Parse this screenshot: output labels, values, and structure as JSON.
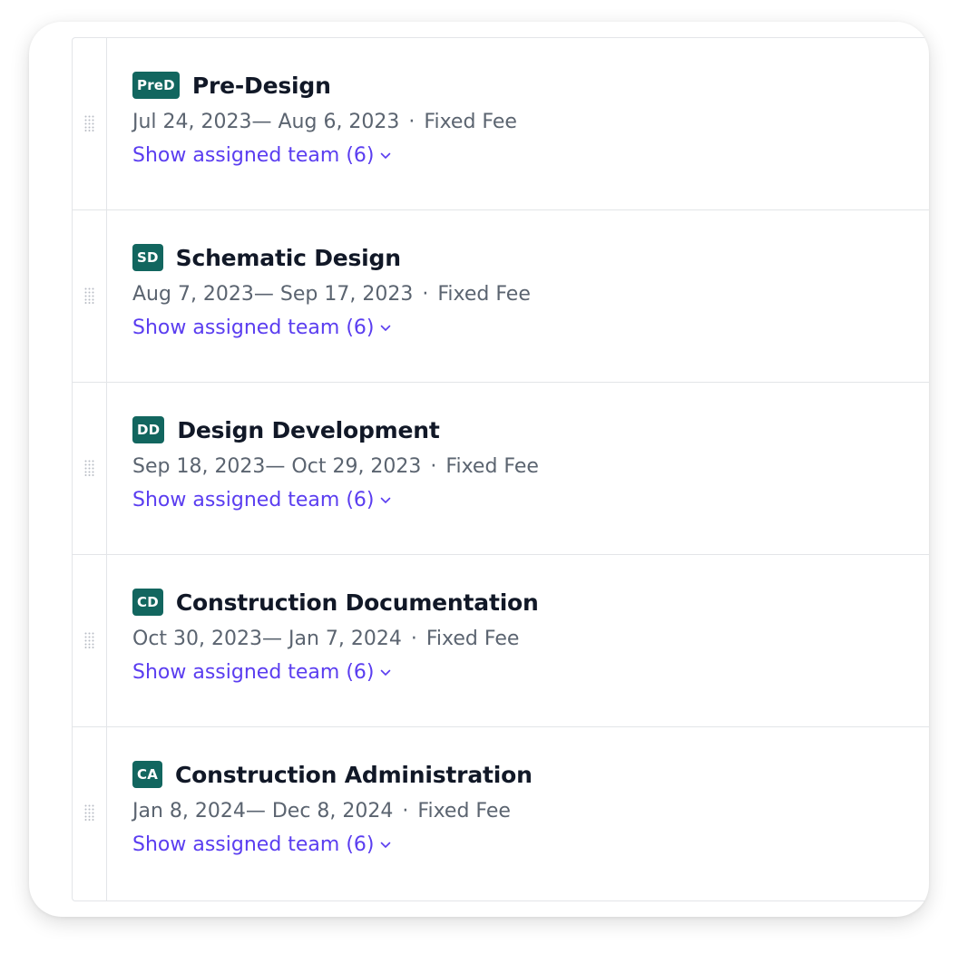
{
  "phases": [
    {
      "badge": "PreD",
      "title": "Pre-Design",
      "dates": "Jul 24, 2023— Aug 6, 2023",
      "fee": "Fixed Fee",
      "team_link": "Show assigned team (6)"
    },
    {
      "badge": "SD",
      "title": "Schematic Design",
      "dates": "Aug 7, 2023— Sep 17, 2023",
      "fee": "Fixed Fee",
      "team_link": "Show assigned team (6)"
    },
    {
      "badge": "DD",
      "title": "Design Development",
      "dates": "Sep 18, 2023— Oct 29, 2023",
      "fee": "Fixed Fee",
      "team_link": "Show assigned team (6)"
    },
    {
      "badge": "CD",
      "title": "Construction Documentation",
      "dates": "Oct 30, 2023— Jan 7, 2024",
      "fee": "Fixed Fee",
      "team_link": "Show assigned team (6)"
    },
    {
      "badge": "CA",
      "title": "Construction Administration",
      "dates": "Jan 8, 2024— Dec 8, 2024",
      "fee": "Fixed Fee",
      "team_link": "Show assigned team (6)"
    }
  ],
  "separator": "·",
  "icons": {
    "drag": "drag-handle-icon",
    "chevron": "chevron-down-icon"
  },
  "colors": {
    "badge": "#12665f",
    "link": "#5a3df0",
    "title": "#111827",
    "meta": "#5b6470"
  }
}
